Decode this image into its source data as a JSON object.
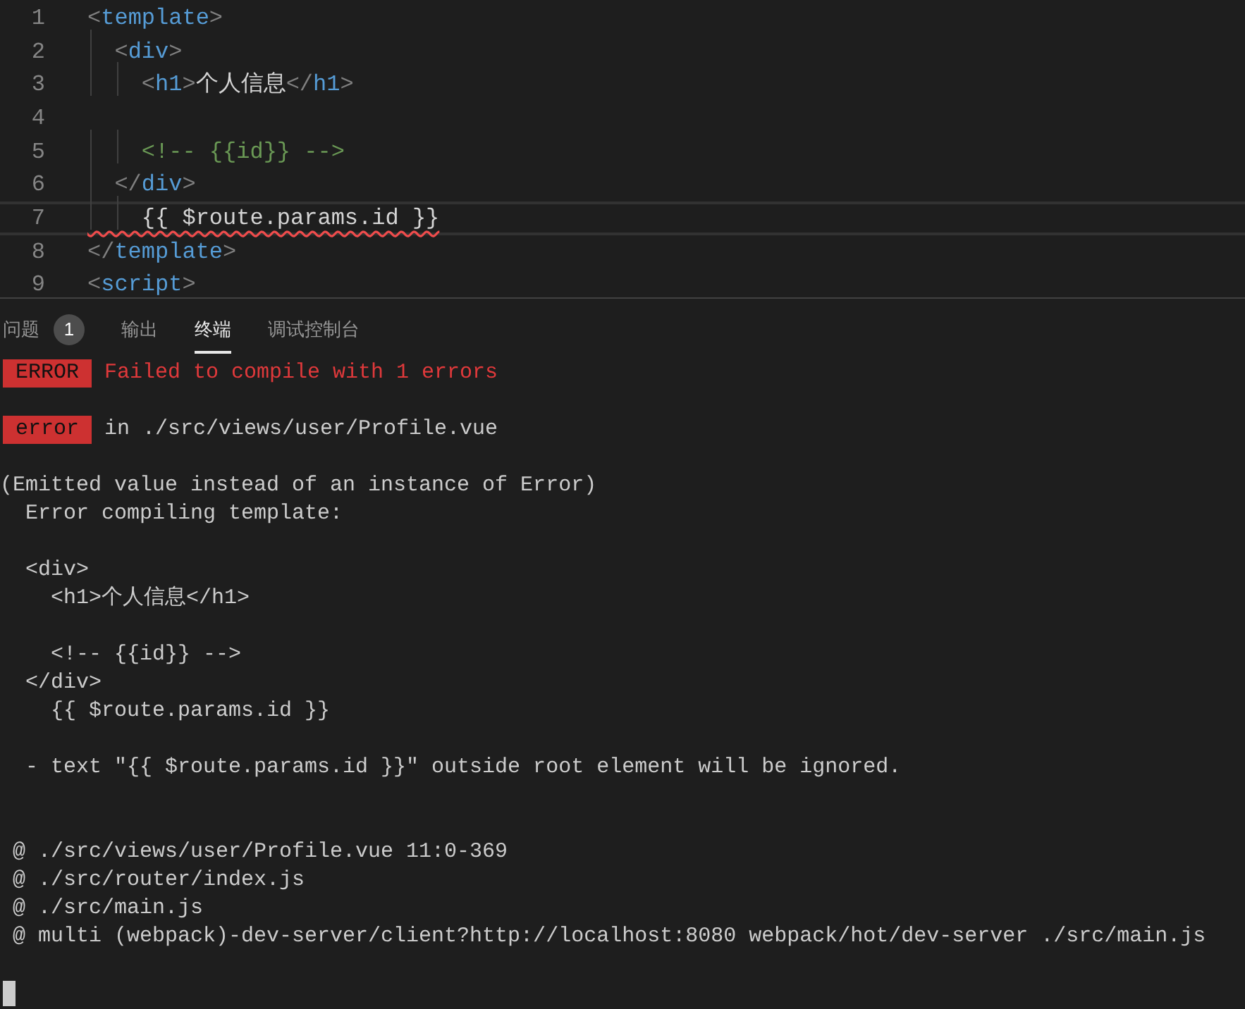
{
  "editor": {
    "lines": [
      {
        "number": "1",
        "current": false,
        "tokens": [
          {
            "kind": "punct",
            "text": "<"
          },
          {
            "kind": "tag",
            "text": "template"
          },
          {
            "kind": "punct",
            "text": ">"
          }
        ]
      },
      {
        "number": "2",
        "current": false,
        "tokens": [
          {
            "kind": "punct",
            "text": "  <"
          },
          {
            "kind": "tag",
            "text": "div"
          },
          {
            "kind": "punct",
            "text": ">"
          }
        ]
      },
      {
        "number": "3",
        "current": false,
        "tokens": [
          {
            "kind": "punct",
            "text": "    <"
          },
          {
            "kind": "tag",
            "text": "h1"
          },
          {
            "kind": "punct",
            "text": ">"
          },
          {
            "kind": "text",
            "text": "个人信息"
          },
          {
            "kind": "punct",
            "text": "</"
          },
          {
            "kind": "tag",
            "text": "h1"
          },
          {
            "kind": "punct",
            "text": ">"
          }
        ]
      },
      {
        "number": "4",
        "current": false
      },
      {
        "number": "5",
        "current": false,
        "tokens": [
          {
            "kind": "comment",
            "text": "    <!-- {{id}} -->"
          }
        ]
      },
      {
        "number": "6",
        "current": false,
        "tokens": [
          {
            "kind": "punct",
            "text": "  </"
          },
          {
            "kind": "tag",
            "text": "div"
          },
          {
            "kind": "punct",
            "text": ">"
          }
        ]
      },
      {
        "number": "7",
        "current": true,
        "tokens": [
          {
            "kind": "text",
            "text": "    {{ $route.params.id }}",
            "squiggle": true
          }
        ]
      },
      {
        "number": "8",
        "current": false,
        "tokens": [
          {
            "kind": "punct",
            "text": "</"
          },
          {
            "kind": "tag",
            "text": "template"
          },
          {
            "kind": "punct",
            "text": ">"
          }
        ]
      },
      {
        "number": "9",
        "current": false,
        "tokens": [
          {
            "kind": "punct",
            "text": "<"
          },
          {
            "kind": "tag",
            "text": "script"
          },
          {
            "kind": "punct",
            "text": ">"
          }
        ]
      }
    ]
  },
  "panel": {
    "tabs": [
      {
        "label": "问题",
        "badge": "1",
        "selected": false
      },
      {
        "label": "输出",
        "selected": false
      },
      {
        "label": "终端",
        "selected": true
      },
      {
        "label": "调试控制台",
        "selected": false
      }
    ],
    "terminal": [
      {
        "kind": "error",
        "badge": "ERROR",
        "text": " Failed to compile with 1 errors"
      },
      {
        "kind": "blank"
      },
      {
        "kind": "badge",
        "badge": "error",
        "text": " in ./src/views/user/Profile.vue"
      },
      {
        "kind": "blank"
      },
      {
        "kind": "text",
        "text": "(Emitted value instead of an instance of Error)"
      },
      {
        "kind": "text",
        "text": "  Error compiling template:"
      },
      {
        "kind": "blank"
      },
      {
        "kind": "text",
        "text": "  <div>"
      },
      {
        "kind": "text",
        "text": "    <h1>个人信息</h1>"
      },
      {
        "kind": "blank"
      },
      {
        "kind": "text",
        "text": "    <!-- {{id}} -->"
      },
      {
        "kind": "text",
        "text": "  </div>"
      },
      {
        "kind": "text",
        "text": "    {{ $route.params.id }}"
      },
      {
        "kind": "blank"
      },
      {
        "kind": "text",
        "text": "  - text \"{{ $route.params.id }}\" outside root element will be ignored."
      },
      {
        "kind": "blank"
      },
      {
        "kind": "blank"
      },
      {
        "kind": "text",
        "text": " @ ./src/views/user/Profile.vue 11:0-369"
      },
      {
        "kind": "text",
        "text": " @ ./src/router/index.js"
      },
      {
        "kind": "text",
        "text": " @ ./src/main.js"
      },
      {
        "kind": "text",
        "text": " @ multi (webpack)-dev-server/client?http://localhost:8080 webpack/hot/dev-server ./src/main.js"
      },
      {
        "kind": "blank"
      },
      {
        "kind": "cursor"
      }
    ]
  }
}
